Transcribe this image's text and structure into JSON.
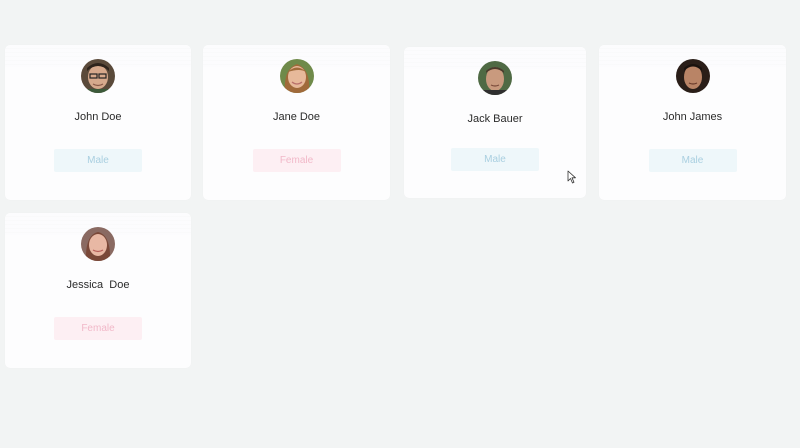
{
  "cards": [
    {
      "name": "John Doe",
      "gender": "Male",
      "avatar_icon": "man-with-glasses-avatar"
    },
    {
      "name": "Jane Doe",
      "gender": "Female",
      "avatar_icon": "woman-avatar"
    },
    {
      "name": "Jack Bauer",
      "gender": "Male",
      "avatar_icon": "man-avatar"
    },
    {
      "name": "John James",
      "gender": "Male",
      "avatar_icon": "man-avatar"
    },
    {
      "name": "Jessica  Doe",
      "gender": "Female",
      "avatar_icon": "girl-avatar"
    }
  ],
  "colors": {
    "male_bg": "#eef7fa",
    "male_text": "#a9cfe0",
    "female_bg": "#fdeff3",
    "female_text": "#f1b8c8"
  }
}
